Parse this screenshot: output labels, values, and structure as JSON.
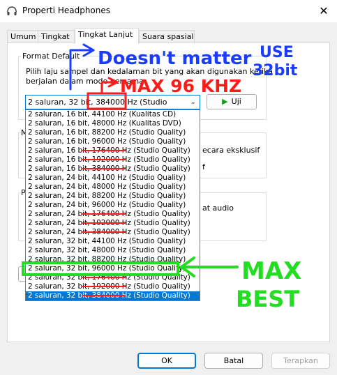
{
  "window": {
    "title": "Properti Headphones",
    "close_glyph": "✕"
  },
  "tabs": [
    {
      "label": "Umum"
    },
    {
      "label": "Tingkat"
    },
    {
      "label": "Tingkat Lanjut"
    },
    {
      "label": "Suara spasial"
    }
  ],
  "format_group": {
    "label": "Format Default",
    "desc_line1": "Pilih laju sampel dan kedalaman bit yang akan digunakan ketika",
    "desc_line2": "berjalan dalam mode bersama.",
    "selected_value": "2 saluran, 32 bit, 384000 Hz (Studio Quality)",
    "test_label": "Uji",
    "options": [
      "2 saluran, 16 bit, 44100 Hz (Kualitas CD)",
      "2 saluran, 16 bit, 48000 Hz (Kualitas DVD)",
      "2 saluran, 16 bit, 88200 Hz (Studio Quality)",
      "2 saluran, 16 bit, 96000 Hz (Studio Quality)",
      "2 saluran, 16 bit, 176400 Hz (Studio Quality)",
      "2 saluran, 16 bit, 192000 Hz (Studio Quality)",
      "2 saluran, 16 bit, 384000 Hz (Studio Quality)",
      "2 saluran, 24 bit, 44100 Hz (Studio Quality)",
      "2 saluran, 24 bit, 48000 Hz (Studio Quality)",
      "2 saluran, 24 bit, 88200 Hz (Studio Quality)",
      "2 saluran, 24 bit, 96000 Hz (Studio Quality)",
      "2 saluran, 24 bit, 176400 Hz (Studio Quality)",
      "2 saluran, 24 bit, 192000 Hz (Studio Quality)",
      "2 saluran, 24 bit, 384000 Hz (Studio Quality)",
      "2 saluran, 32 bit, 44100 Hz (Studio Quality)",
      "2 saluran, 32 bit, 48000 Hz (Studio Quality)",
      "2 saluran, 32 bit, 88200 Hz (Studio Quality)",
      "2 saluran, 32 bit, 96000 Hz (Studio Quality)",
      "2 saluran, 32 bit, 176400 Hz (Studio Quality)",
      "2 saluran, 32 bit, 192000 Hz (Studio Quality)",
      "2 saluran, 32 bit, 384000 Hz (Studio Quality)"
    ],
    "selected_index": 20
  },
  "hidden_fragments": {
    "group2_label": "M",
    "group2_text1": "ecara eksklusif",
    "group2_text2": "f",
    "group3_label": "P",
    "group3_text1": "at audio"
  },
  "buttons": {
    "ok": "OK",
    "cancel": "Batal",
    "apply": "Terapkan"
  },
  "annotations": {
    "note1_line1": "Doesn't matter",
    "note1_line2": "USE",
    "note1_line3": "32bit",
    "note2": "MAX 96 KHZ",
    "note3_line1": "MAX",
    "note3_line2": "BEST"
  },
  "colors": {
    "accent": "#0078d4",
    "ink_blue": "#1a3cff",
    "ink_red": "#ff1a1a",
    "ink_green": "#22dd22"
  }
}
